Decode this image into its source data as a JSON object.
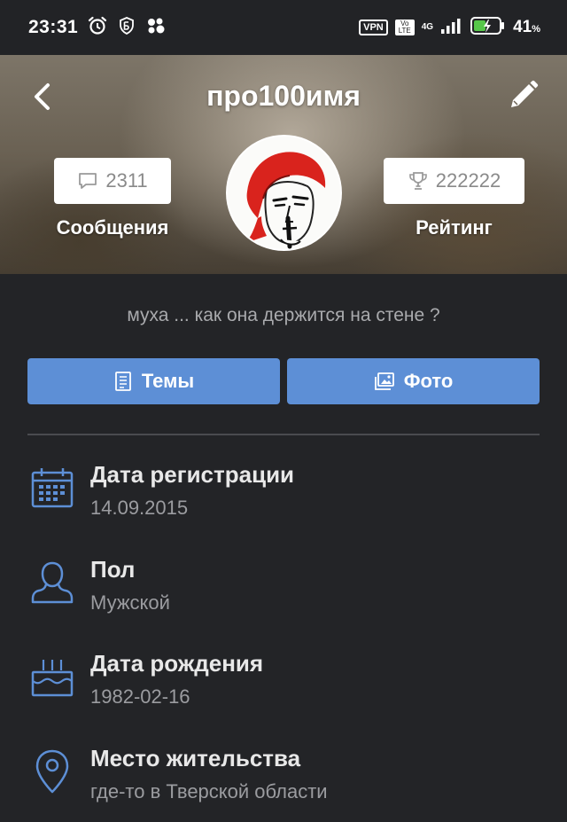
{
  "status_bar": {
    "time": "23:31",
    "vpn": "VPN",
    "volte": "Vo LTE",
    "network": "4G",
    "battery_percent": "41",
    "battery_unit": "%"
  },
  "header": {
    "username": "про100имя",
    "messages": {
      "count": "2311",
      "label": "Сообщения"
    },
    "rating": {
      "value": "222222",
      "label": "Рейтинг"
    }
  },
  "profile": {
    "status": "муха ... как она держится на стене ?"
  },
  "tabs": {
    "topics": "Темы",
    "photo": "Фото"
  },
  "info": {
    "registration": {
      "title": "Дата регистрации",
      "value": "14.09.2015"
    },
    "gender": {
      "title": "Пол",
      "value": "Мужской"
    },
    "birthday": {
      "title": "Дата рождения",
      "value": "1982-02-16"
    },
    "location": {
      "title": "Место жительства",
      "value": "где-то в Тверской области"
    }
  },
  "colors": {
    "accent": "#5d8fd6",
    "icon": "#5d8fd6",
    "background": "#232427"
  }
}
